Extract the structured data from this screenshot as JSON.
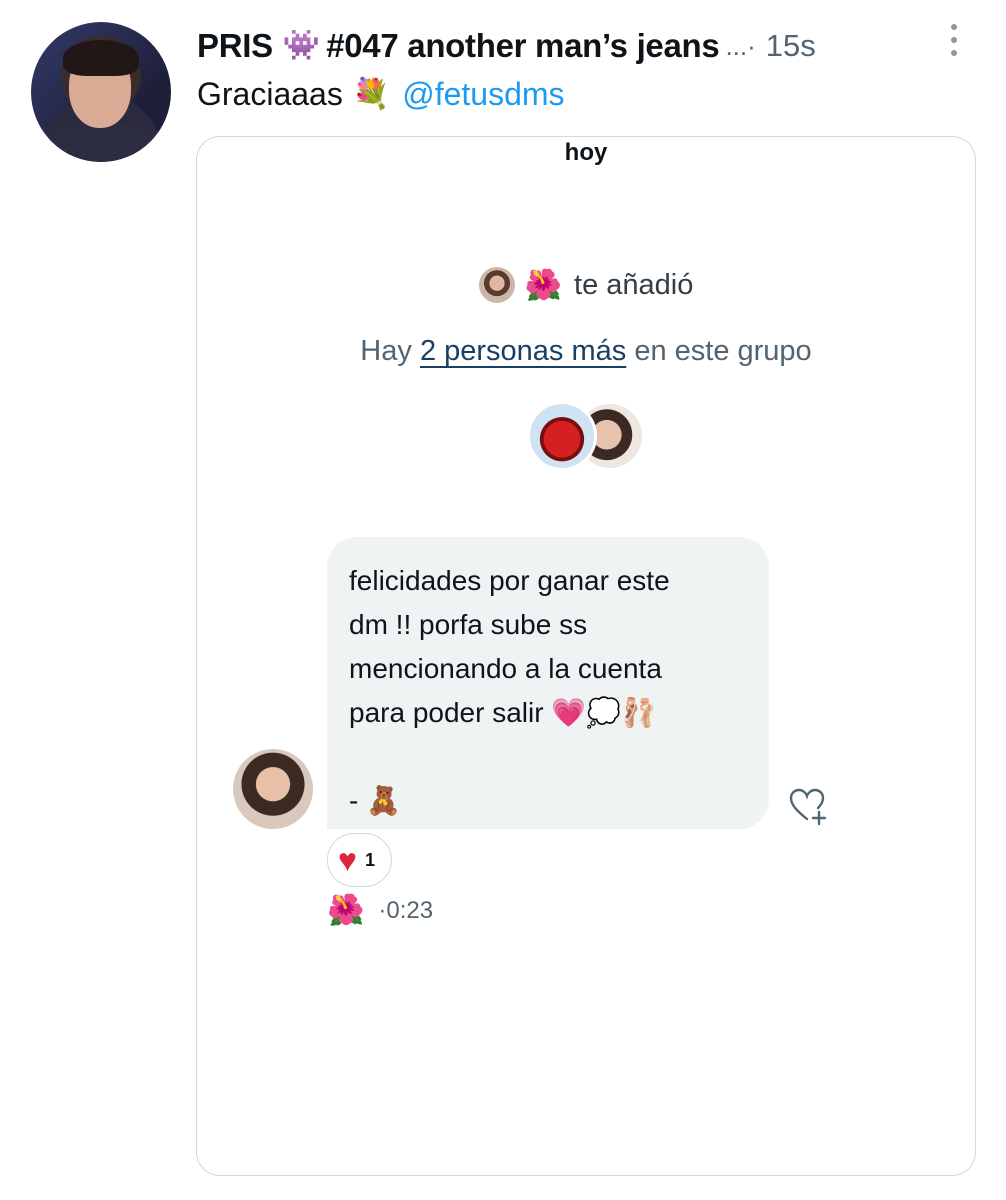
{
  "tweet": {
    "display_name": "PRIS",
    "name_icon": "space-invader-icon",
    "name_suffix": "#047 another man’s jeans",
    "name_ellipsis": "...·",
    "time": "15s",
    "text": "Graciaaas",
    "text_icon": "bouquet-icon",
    "mention": "@fetusdms"
  },
  "dm": {
    "day_label": "hoy",
    "added_text": "te añadió",
    "people_prefix": "Hay",
    "people_link": "2 personas más",
    "people_suffix": "en este grupo",
    "message_lines": [
      "felicidades por ganar este",
      "dm !! porfa sube ss",
      "mencionando a la cuenta",
      "para poder salir"
    ],
    "message_signature": "-",
    "reaction_count": "1",
    "meta_time": "·0:23"
  },
  "colors": {
    "mention": "#1d9bf0",
    "bubble": "#eff3f4",
    "reaction_heart": "#e0243e",
    "secondary_text": "#536471"
  }
}
